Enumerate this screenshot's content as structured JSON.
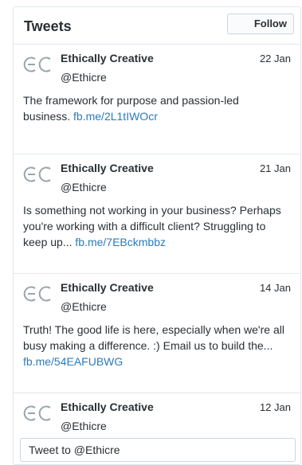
{
  "header": {
    "title": "Tweets",
    "follow_label": "Follow"
  },
  "tweets": [
    {
      "name": "Ethically Creative",
      "handle": "@Ethicre",
      "date": "22 Jan",
      "text": "The framework for purpose and passion-led business. ",
      "link": "fb.me/2L1tIWOcr",
      "avatar_icon": "ec-logo-icon"
    },
    {
      "name": "Ethically Creative",
      "handle": "@Ethicre",
      "date": "21 Jan",
      "text": "Is something not working in your business? Perhaps you're working with a difficult client? Struggling to keep up... ",
      "link": "fb.me/7EBckmbbz",
      "avatar_icon": "ec-logo-icon"
    },
    {
      "name": "Ethically Creative",
      "handle": "@Ethicre",
      "date": "14 Jan",
      "text": "Truth! The good life is here, especially when we're all busy making a difference. :) Email us to build the... ",
      "link": "fb.me/54EAFUBWG",
      "avatar_icon": "ec-logo-icon"
    },
    {
      "name": "Ethically Creative",
      "handle": "@Ethicre",
      "date": "12 Jan",
      "text": "",
      "link": "",
      "avatar_icon": "ec-logo-icon"
    }
  ],
  "compose": {
    "label": "Tweet to @Ethicre"
  },
  "colors": {
    "link": "#2b7bb9",
    "border": "#e1e8ed",
    "text": "#292f33",
    "logo": "#9aa4ab"
  }
}
